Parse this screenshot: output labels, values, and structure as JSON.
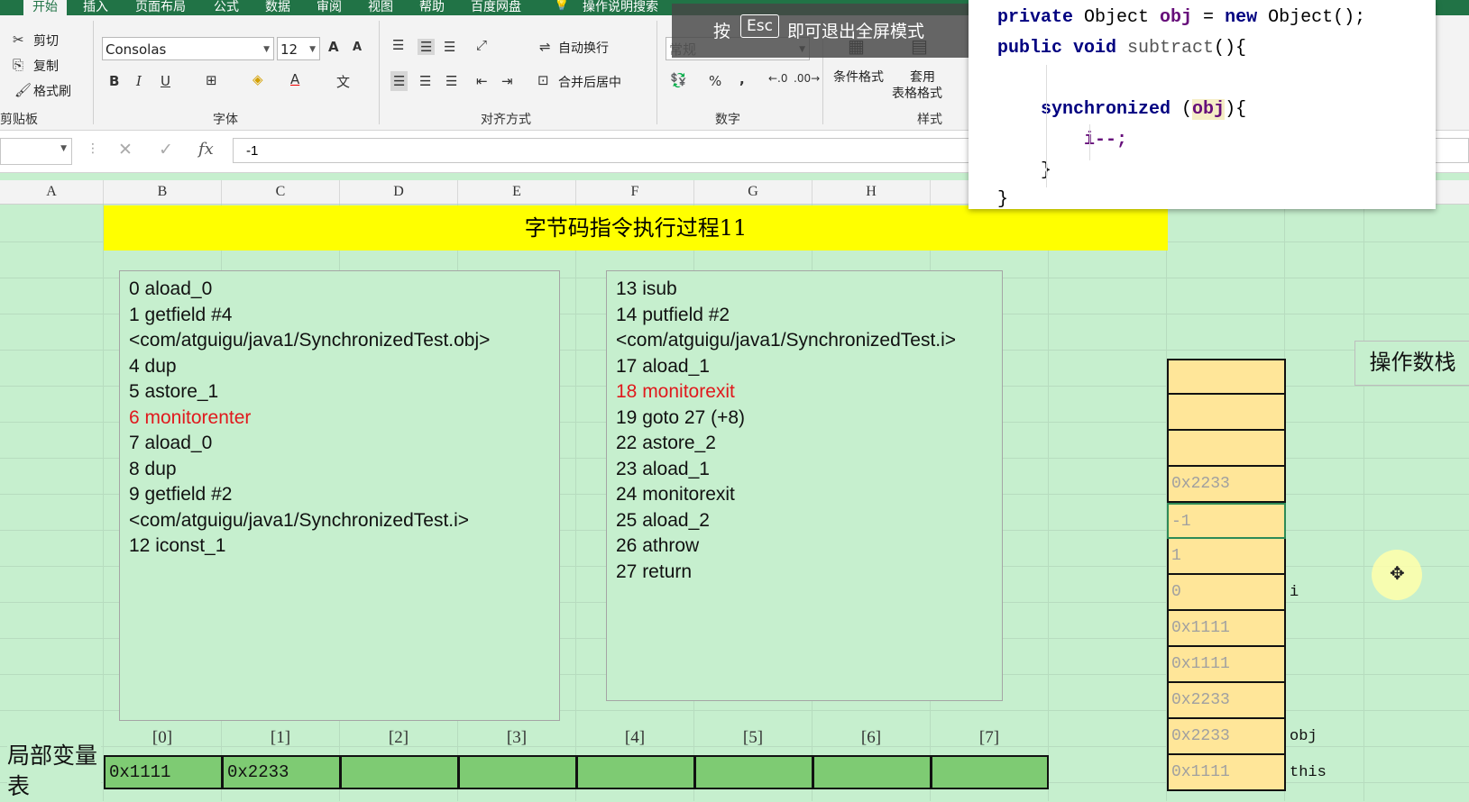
{
  "ribbon": {
    "tabs": [
      "开始",
      "插入",
      "页面布局",
      "公式",
      "数据",
      "审阅",
      "视图",
      "帮助",
      "百度网盘",
      "操作说明搜索"
    ],
    "clipboard": {
      "cut": "剪切",
      "copy": "复制",
      "format_painter": "格式刷",
      "group": "剪贴板"
    },
    "font": {
      "name": "Consolas",
      "size": "12",
      "group": "字体",
      "grow": "A",
      "shrink": "A",
      "bold": "B",
      "italic": "I",
      "underline": "U",
      "color_letter": "A"
    },
    "alignment": {
      "wrap": "自动换行",
      "merge": "合并后居中",
      "group": "对齐方式"
    },
    "number": {
      "format": "常规",
      "group": "数字",
      "percent": "%",
      "comma": ","
    },
    "styles": {
      "conditional": "条件格式",
      "table1": "套用",
      "table2": "表格格式",
      "group": "样式"
    },
    "accent": "#217346"
  },
  "fullscreen_tip": {
    "pre": "按",
    "key": "Esc",
    "post": "即可退出全屏模式"
  },
  "formula_bar": {
    "value": "-1",
    "fx": "fx"
  },
  "columns": [
    "A",
    "B",
    "C",
    "D",
    "E",
    "F",
    "G",
    "H"
  ],
  "title": "字节码指令执行过程11",
  "left_instructions": [
    {
      "text": " 0 aload_0",
      "red": false
    },
    {
      "text": " 1 getfield #4",
      "red": false
    },
    {
      "text": "<com/atguigu/java1/SynchronizedTest.obj>",
      "red": false
    },
    {
      "text": " 4 dup",
      "red": false
    },
    {
      "text": " 5 astore_1",
      "red": false
    },
    {
      "text": " 6 monitorenter",
      "red": true
    },
    {
      "text": " 7 aload_0",
      "red": false
    },
    {
      "text": " 8 dup",
      "red": false
    },
    {
      "text": " 9 getfield #2",
      "red": false
    },
    {
      "text": "<com/atguigu/java1/SynchronizedTest.i>",
      "red": false
    },
    {
      "text": "12 iconst_1",
      "red": false
    }
  ],
  "right_instructions": [
    {
      "text": "13 isub",
      "red": false
    },
    {
      "text": "14 putfield #2",
      "red": false
    },
    {
      "text": "<com/atguigu/java1/SynchronizedTest.i>",
      "red": false
    },
    {
      "text": "17 aload_1",
      "red": false
    },
    {
      "text": "18 monitorexit",
      "red": true
    },
    {
      "text": "19 goto 27 (+8)",
      "red": false
    },
    {
      "text": "22 astore_2",
      "red": false
    },
    {
      "text": "23 aload_1",
      "red": false
    },
    {
      "text": "24 monitorexit",
      "red": false
    },
    {
      "text": "25 aload_2",
      "red": false
    },
    {
      "text": "26 athrow",
      "red": false
    },
    {
      "text": "27 return",
      "red": false
    }
  ],
  "code": {
    "l1_kw": "private",
    "l1_type": " Object ",
    "l1_var": "obj",
    "l1_eq": " = ",
    "l1_new": "new",
    "l1_rest": " Object();",
    "l2_kw1": "public",
    "l2_kw2": " void ",
    "l2_fn": "subtract",
    "l2_rest": "(){",
    "l3_kw": "synchronized",
    "l3_open": " (",
    "l3_var": "obj",
    "l3_close": "){",
    "l4": "i--;",
    "l5": "}",
    "l6": "}"
  },
  "local_vars": {
    "label": "局部变量表",
    "indices": [
      "[0]",
      "[1]",
      "[2]",
      "[3]",
      "[4]",
      "[5]",
      "[6]",
      "[7]"
    ],
    "values": [
      "0x1111",
      "0x2233",
      "",
      "",
      "",
      "",
      "",
      ""
    ]
  },
  "operand_stack": {
    "title": "操作数栈",
    "cells": [
      {
        "value": "",
        "label": ""
      },
      {
        "value": "",
        "label": ""
      },
      {
        "value": "",
        "label": ""
      },
      {
        "value": "0x2233",
        "label": ""
      },
      {
        "value": "-1",
        "label": ""
      },
      {
        "value": "1",
        "label": ""
      },
      {
        "value": "0",
        "label": "i"
      },
      {
        "value": "0x1111",
        "label": ""
      },
      {
        "value": "0x1111",
        "label": ""
      },
      {
        "value": "0x2233",
        "label": ""
      },
      {
        "value": "0x2233",
        "label": "obj"
      },
      {
        "value": "0x1111",
        "label": "this"
      }
    ]
  }
}
